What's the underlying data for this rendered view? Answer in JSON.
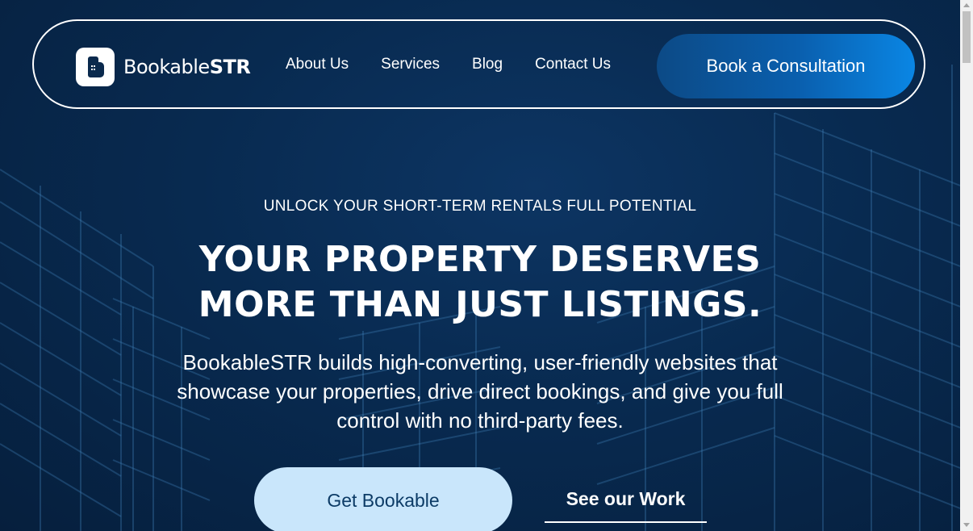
{
  "brand": {
    "name_light": "Bookable",
    "name_bold": "STR",
    "icon": "bookable-logo-icon"
  },
  "nav": {
    "links": [
      "About Us",
      "Services",
      "Blog",
      "Contact Us"
    ],
    "cta_label": "Book a Consultation"
  },
  "hero": {
    "eyebrow": "UNLOCK YOUR SHORT-TERM RENTALS FULL POTENTIAL",
    "headline_line1": "YOUR PROPERTY DESERVES",
    "headline_line2": "MORE THAN JUST LISTINGS.",
    "subtext": "BookableSTR builds high-converting, user-friendly websites that showcase your properties, drive direct bookings, and give you full control with no third-party fees.",
    "primary_button": "Get Bookable",
    "secondary_button": "See our Work"
  },
  "colors": {
    "background": "#082a50",
    "accent": "#0a86e4",
    "primary_button_bg": "#c9e6fb",
    "primary_button_text": "#0c3b66"
  }
}
